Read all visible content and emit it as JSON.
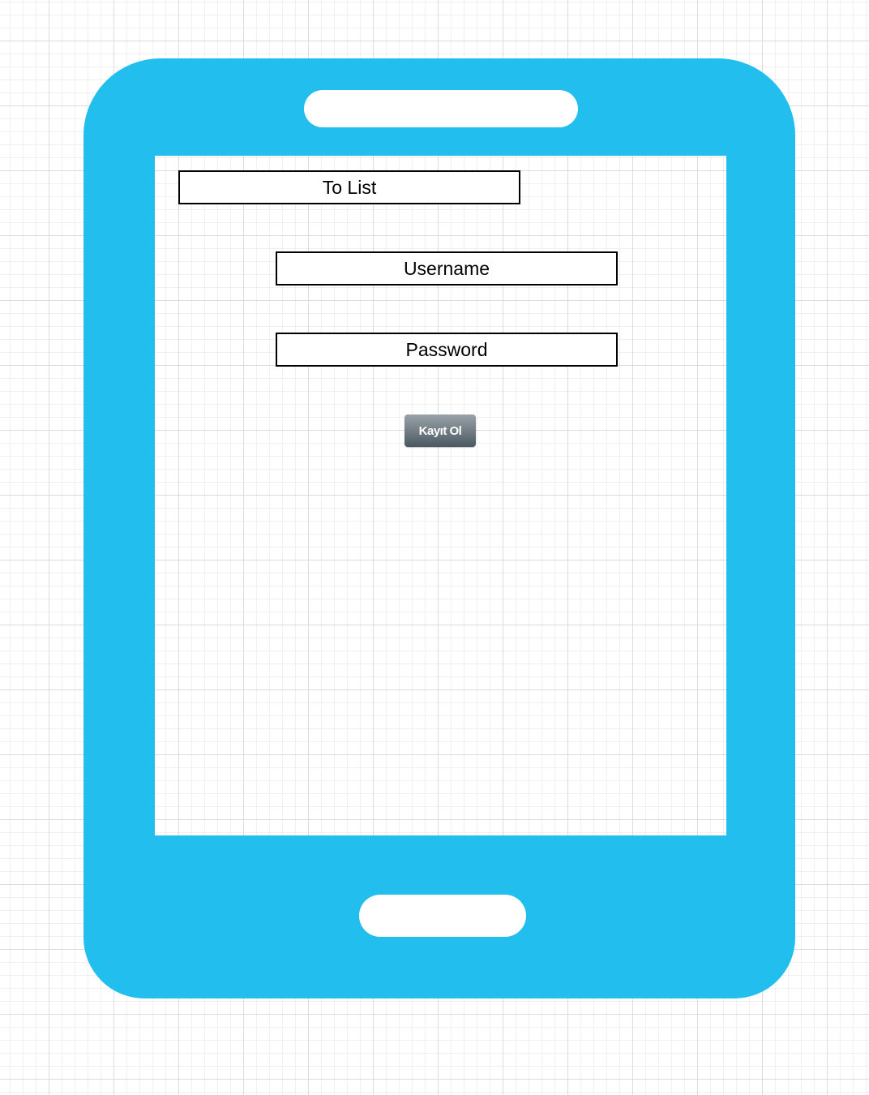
{
  "colors": {
    "device_body": "#22BFEE",
    "button_gradient_top": "#9aa3a9",
    "button_gradient_bottom": "#4b5861"
  },
  "device": {
    "icon": "tablet-device-icon"
  },
  "screen": {
    "title": "To List",
    "username_field": "Username",
    "password_field": "Password",
    "register_button": "Kayıt Ol"
  }
}
